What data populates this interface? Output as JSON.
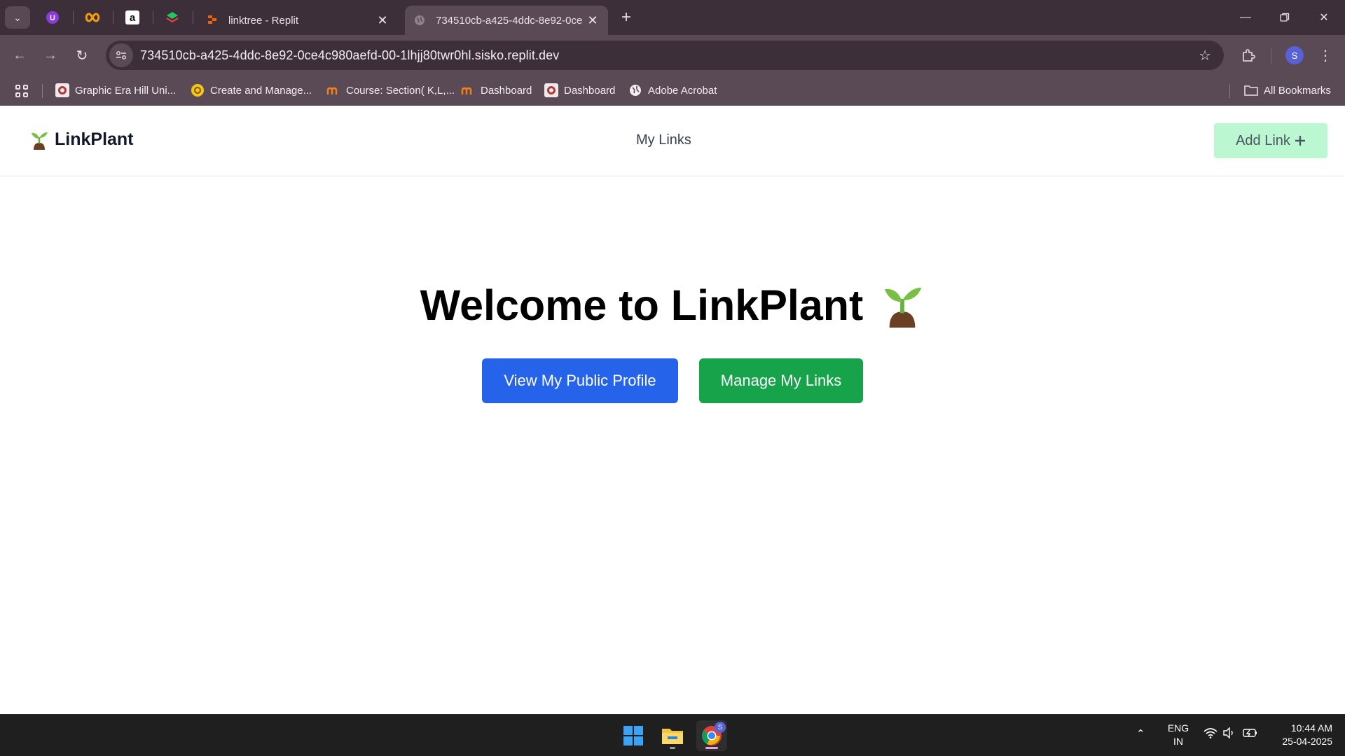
{
  "browser": {
    "tabs": [
      {
        "title": "linktree - Replit",
        "active": false
      },
      {
        "title": "734510cb-a425-4ddc-8e92-0ce",
        "active": true
      }
    ],
    "pinned_icons": [
      "uolo-icon",
      "infinity-icon",
      "amazon-icon",
      "codecademy-icon"
    ],
    "url": "734510cb-a425-4ddc-8e92-0ce4c980aefd-00-1lhjj80twr0hl.sisko.replit.dev",
    "profile_initial": "S",
    "bookmarks": [
      {
        "label": "Graphic Era Hill Uni...",
        "icon": "university-icon"
      },
      {
        "label": "Create and Manage...",
        "icon": "yellow-circle-icon"
      },
      {
        "label": "Course: Section( K,L,...",
        "icon": "moodle-icon"
      },
      {
        "label": "Dashboard",
        "icon": "moodle-icon"
      },
      {
        "label": "Dashboard",
        "icon": "university-icon"
      },
      {
        "label": "Adobe Acrobat",
        "icon": "globe-icon"
      }
    ],
    "all_bookmarks_label": "All Bookmarks"
  },
  "app": {
    "brand": "LinkPlant",
    "nav_link": "My Links",
    "add_link_label": "Add Link",
    "hero_title": "Welcome to LinkPlant",
    "primary_button": "View My Public Profile",
    "secondary_button": "Manage My Links",
    "colors": {
      "primary": "#2563eb",
      "secondary": "#16a34a",
      "add_link_bg": "#bbf7d0"
    }
  },
  "taskbar": {
    "lang_line1": "ENG",
    "lang_line2": "IN",
    "time": "10:44 AM",
    "date": "25-04-2025",
    "chrome_badge": "S"
  }
}
